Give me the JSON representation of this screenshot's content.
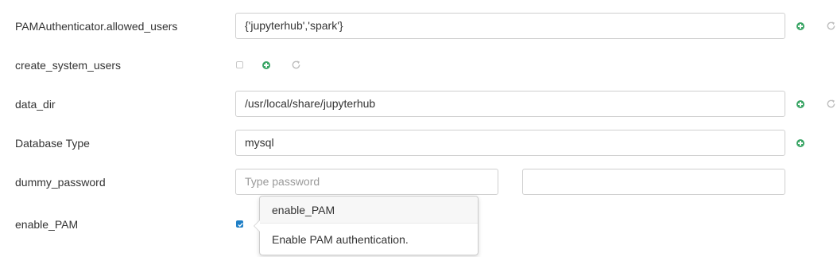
{
  "fields": [
    {
      "name": "PAMAuthenticator.allowed_users",
      "value": "{'jupyterhub','spark'}"
    },
    {
      "name": "create_system_users",
      "checked": false
    },
    {
      "name": "data_dir",
      "value": "/usr/local/share/jupyterhub"
    },
    {
      "name": "Database Type",
      "value": "mysql"
    },
    {
      "name": "dummy_password",
      "placeholder": "Type password",
      "confirm_value": ""
    },
    {
      "name": "enable_PAM",
      "checked": true
    }
  ],
  "popover": {
    "title": "enable_PAM",
    "content": "Enable PAM authentication."
  },
  "colors": {
    "add_icon": "#3aa565",
    "refresh_icon": "#bdbdbd",
    "checkbox_checked": "#1f7fc6"
  },
  "icons": {
    "add": "plus-circle-icon",
    "refresh": "refresh-icon"
  }
}
